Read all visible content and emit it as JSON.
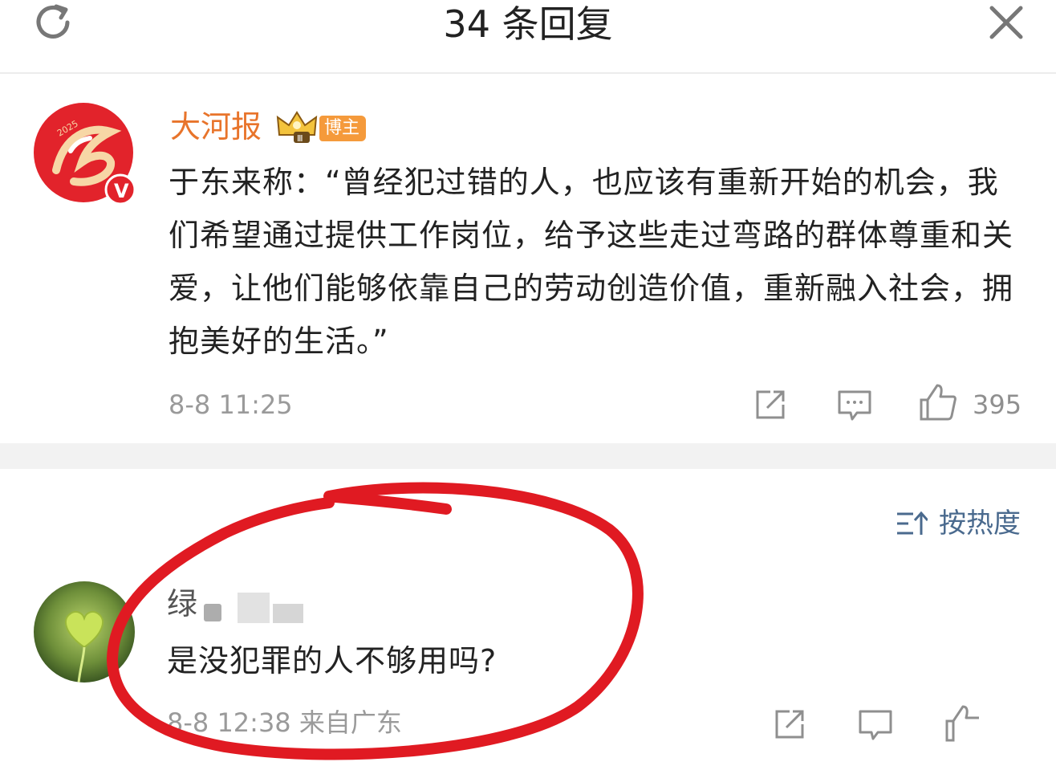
{
  "header": {
    "title": "34 条回复",
    "refresh_icon": "refresh-icon",
    "close_icon": "close-icon"
  },
  "post": {
    "author": "大河报",
    "badge": "博主",
    "crown_level": "Ⅲ",
    "verified_mark": "V",
    "avatar_year": "2025",
    "body": "于东来称：“曾经犯过错的人，也应该有重新开始的机会，我们希望通过提供工作岗位，给予这些走过弯路的群体尊重和关爱，让他们能够依靠自己的劳动创造价值，重新融入社会，拥抱美好的生活。”",
    "time": "8-8 11:25",
    "like_count": "395",
    "accent_color": "#e8742b",
    "icons": [
      "share-icon",
      "comment-icon",
      "like-icon"
    ]
  },
  "sort": {
    "label": "按热度",
    "icon": "sort-icon"
  },
  "reply": {
    "name": "绿",
    "body": "是没犯罪的人不够用吗?",
    "meta": "8-8 12:38  来自广东",
    "icons": [
      "share-icon",
      "comment-icon",
      "like-icon"
    ]
  },
  "annotation": {
    "color": "#e01a22"
  }
}
